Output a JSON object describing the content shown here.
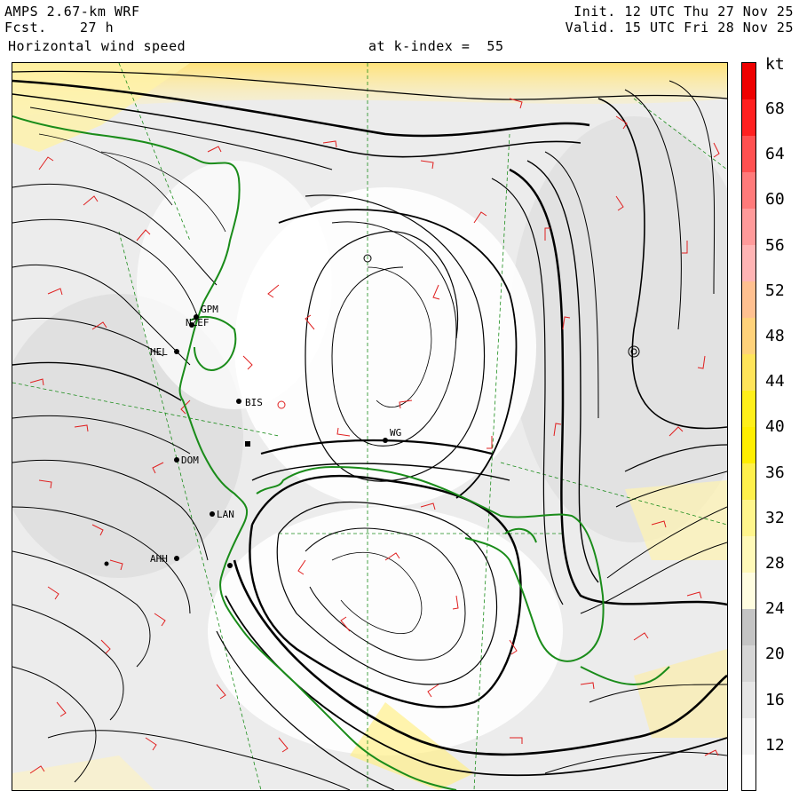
{
  "header": {
    "model": "AMPS 2.67-km WRF",
    "forecast_label": "Fcst.",
    "forecast_hours": "27 h",
    "field": "Horizontal wind speed",
    "level": "at k-index =  55",
    "init": "Init. 12 UTC Thu 27 Nov 25",
    "valid": "Valid. 15 UTC Fri 28 Nov 25"
  },
  "colorbar": {
    "unit": "kt",
    "labels": [
      "68",
      "64",
      "60",
      "56",
      "52",
      "48",
      "44",
      "40",
      "36",
      "32",
      "28",
      "24",
      "20",
      "16",
      "12"
    ],
    "colors": [
      "#ffffff",
      "#f4f4f4",
      "#e6e6e6",
      "#d6d6d6",
      "#c4c4c4",
      "#fffde0",
      "#fff9b8",
      "#fff58c",
      "#fff04c",
      "#ffee00",
      "#ffef1a",
      "#ffe45a",
      "#ffd27a",
      "#ffc090",
      "#ffb4b4",
      "#ff9a9a",
      "#ff7a7a",
      "#ff5050",
      "#ff2020",
      "#ee0000"
    ]
  },
  "stations": [
    {
      "id": "GPM",
      "label": "GPM"
    },
    {
      "id": "NZ",
      "label": "NZEF"
    },
    {
      "id": "HEL",
      "label": "HEL"
    },
    {
      "id": "BIS",
      "label": "BIS"
    },
    {
      "id": "WG",
      "label": "WG"
    },
    {
      "id": "DOM",
      "label": "DOM"
    },
    {
      "id": "LAN",
      "label": "LAN"
    },
    {
      "id": "AHH",
      "label": "AHH"
    }
  ],
  "colors": {
    "coastline": "#1a8c1a",
    "streamline": "#000000",
    "barb": "#e02020",
    "grid": "#1a8c1a"
  }
}
